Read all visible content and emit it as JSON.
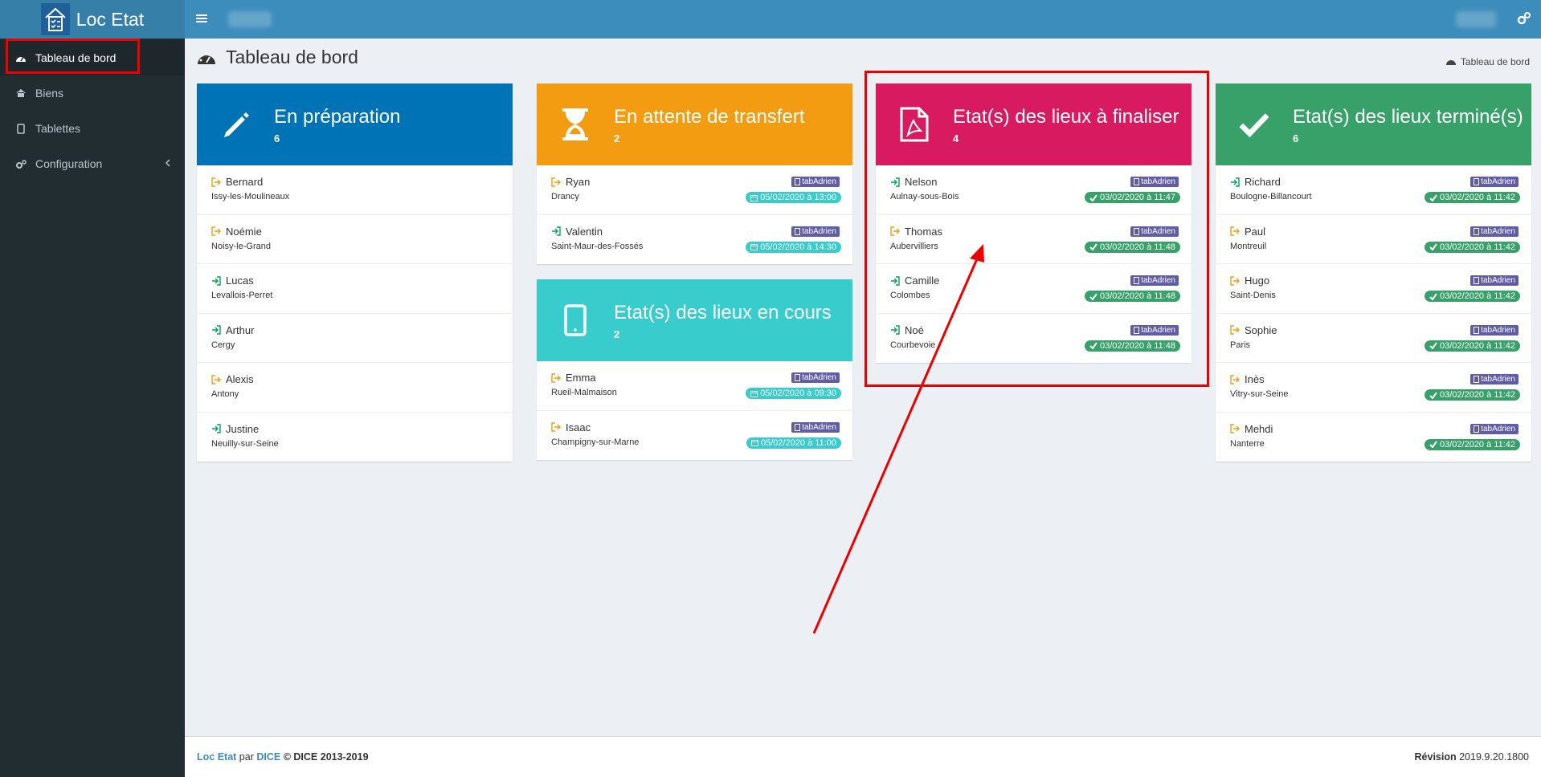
{
  "app": {
    "title": "Loc Etat"
  },
  "sidebar": {
    "items": [
      {
        "label": "Tableau de bord",
        "icon": "dashboard-icon"
      },
      {
        "label": "Biens",
        "icon": "home-icon"
      },
      {
        "label": "Tablettes",
        "icon": "tablet-icon"
      },
      {
        "label": "Configuration",
        "icon": "cogs-icon"
      }
    ]
  },
  "page": {
    "title": "Tableau de bord",
    "breadcrumb": "Tableau de bord"
  },
  "colors": {
    "blue": "#0073b7",
    "orange": "#f39c12",
    "pink": "#d81b60",
    "green": "#38a169",
    "teal": "#39cccc",
    "purple": "#605ca8",
    "accent": "#3c8dbc"
  },
  "cards": {
    "prep": {
      "title": "En préparation",
      "count": "6",
      "rows": [
        {
          "name": "Bernard",
          "city": "Issy-les-Moulineaux"
        },
        {
          "name": "Noémie",
          "city": "Noisy-le-Grand"
        },
        {
          "name": "Lucas",
          "city": "Levallois-Perret"
        },
        {
          "name": "Arthur",
          "city": "Cergy"
        },
        {
          "name": "Alexis",
          "city": "Antony"
        },
        {
          "name": "Justine",
          "city": "Neuilly-sur-Seine"
        }
      ]
    },
    "transfer": {
      "title": "En attente de transfert",
      "count": "2",
      "rows": [
        {
          "name": "Ryan",
          "city": "Drancy",
          "tag": "tabAdrien",
          "date": "05/02/2020 à 13:00"
        },
        {
          "name": "Valentin",
          "city": "Saint-Maur-des-Fossés",
          "tag": "tabAdrien",
          "date": "05/02/2020 à 14:30"
        }
      ]
    },
    "encours": {
      "title": "Etat(s) des lieux en cours",
      "count": "2",
      "rows": [
        {
          "name": "Emma",
          "city": "Rueil-Malmaison",
          "tag": "tabAdrien",
          "date": "05/02/2020 à 09:30"
        },
        {
          "name": "Isaac",
          "city": "Champigny-sur-Marne",
          "tag": "tabAdrien",
          "date": "05/02/2020 à 11:00"
        }
      ]
    },
    "finaliser": {
      "title": "Etat(s) des lieux à finaliser",
      "count": "4",
      "rows": [
        {
          "name": "Nelson",
          "city": "Aulnay-sous-Bois",
          "tag": "tabAdrien",
          "date": "03/02/2020 à 11:47"
        },
        {
          "name": "Thomas",
          "city": "Aubervilliers",
          "tag": "tabAdrien",
          "date": "03/02/2020 à 11:48"
        },
        {
          "name": "Camille",
          "city": "Colombes",
          "tag": "tabAdrien",
          "date": "03/02/2020 à 11:48"
        },
        {
          "name": "Noé",
          "city": "Courbevoie",
          "tag": "tabAdrien",
          "date": "03/02/2020 à 11:48"
        }
      ]
    },
    "termine": {
      "title": "Etat(s) des lieux terminé(s)",
      "count": "6",
      "rows": [
        {
          "name": "Richard",
          "city": "Boulogne-Billancourt",
          "tag": "tabAdrien",
          "date": "03/02/2020 à 11:42"
        },
        {
          "name": "Paul",
          "city": "Montreuil",
          "tag": "tabAdrien",
          "date": "03/02/2020 à 11:42"
        },
        {
          "name": "Hugo",
          "city": "Saint-Denis",
          "tag": "tabAdrien",
          "date": "03/02/2020 à 11:42"
        },
        {
          "name": "Sophie",
          "city": "Paris",
          "tag": "tabAdrien",
          "date": "03/02/2020 à 11:42"
        },
        {
          "name": "Inès",
          "city": "Vitry-sur-Seine",
          "tag": "tabAdrien",
          "date": "03/02/2020 à 11:42"
        },
        {
          "name": "Mehdi",
          "city": "Nanterre",
          "tag": "tabAdrien",
          "date": "03/02/2020 à 11:42"
        }
      ]
    }
  },
  "footer": {
    "app_link": "Loc Etat",
    "by": "par",
    "company_link": "DICE",
    "copyright": "© DICE 2013-2019",
    "revision_label": "Révision",
    "revision_value": "2019.9.20.1800"
  }
}
